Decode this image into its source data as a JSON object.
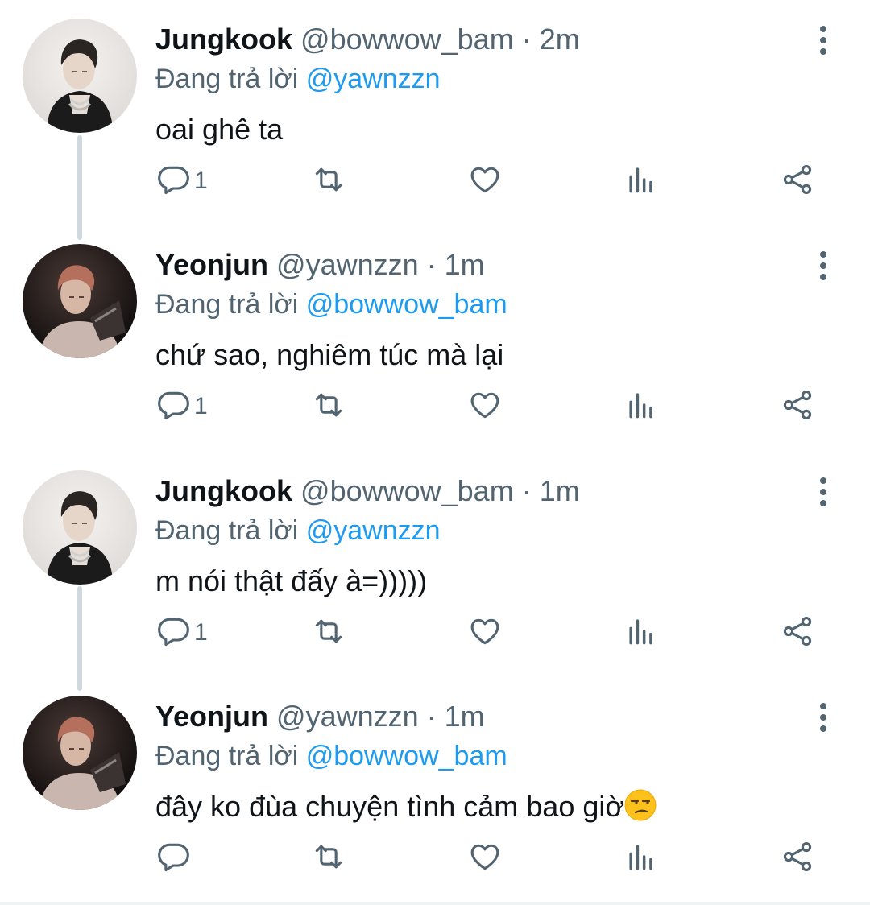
{
  "tweets": [
    {
      "name": "Jungkook",
      "handle": "@bowwow_bam",
      "time": "· 2m",
      "reply_prefix": "Đang trả lời",
      "reply_to": "@yawnzzn",
      "text": "oai ghê ta",
      "reply_count": "1",
      "avatar": "avatar-jungkook"
    },
    {
      "name": "Yeonjun",
      "handle": "@yawnzzn",
      "time": "· 1m",
      "reply_prefix": "Đang trả lời",
      "reply_to": "@bowwow_bam",
      "text": "chứ sao, nghiêm túc mà lại",
      "reply_count": "1",
      "avatar": "avatar-yeonjun"
    },
    {
      "name": "Jungkook",
      "handle": "@bowwow_bam",
      "time": "· 1m",
      "reply_prefix": "Đang trả lời",
      "reply_to": "@yawnzzn",
      "text": "m nói thật đấy à=)))))",
      "reply_count": "1",
      "avatar": "avatar-jungkook"
    },
    {
      "name": "Yeonjun",
      "handle": "@yawnzzn",
      "time": "· 1m",
      "reply_prefix": "Đang trả lời",
      "reply_to": "@bowwow_bam",
      "text": "đây ko đùa chuyện tình cảm bao giờ",
      "trailing_emoji": "unamused-face",
      "reply_count": "",
      "avatar": "avatar-yeonjun"
    }
  ],
  "colors": {
    "text": "#0f1419",
    "muted": "#536471",
    "mention": "#1d9bf0",
    "thread_line": "#cfd9de"
  },
  "icons": [
    "reply-icon",
    "retweet-icon",
    "like-icon",
    "views-icon",
    "share-icon",
    "more-options-icon"
  ]
}
